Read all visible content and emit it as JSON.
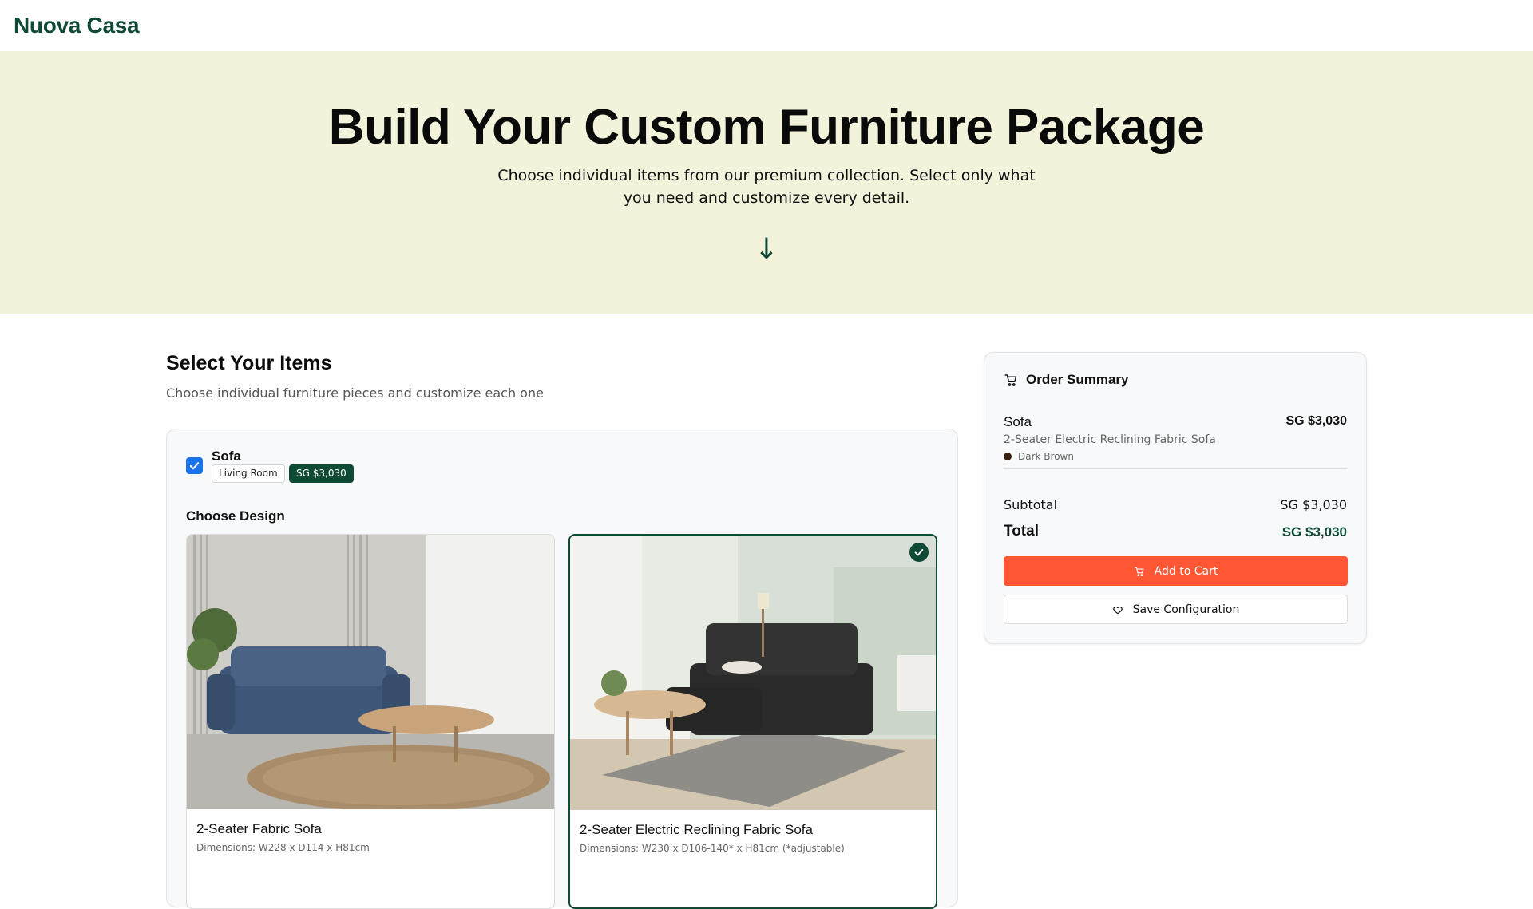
{
  "header": {
    "brand": "Nuova Casa"
  },
  "hero": {
    "title": "Build Your Custom Furniture Package",
    "subtitle": "Choose individual items from our premium collection. Select only what you need and customize every detail.",
    "arrow": "↓"
  },
  "items_section": {
    "title": "Select Your Items",
    "subtitle": "Choose individual furniture pieces and customize each one",
    "item": {
      "name": "Sofa",
      "checked": true,
      "room_tag": "Living Room",
      "price_tag": "SG $3,030",
      "choose_design_label": "Choose Design",
      "designs": [
        {
          "name": "2-Seater Fabric Sofa",
          "dimensions": "Dimensions: W228 x D114 x H81cm",
          "selected": false
        },
        {
          "name": "2-Seater Electric Reclining Fabric Sofa",
          "dimensions": "Dimensions: W230 x D106-140* x H81cm (*adjustable)",
          "selected": true
        }
      ]
    }
  },
  "summary": {
    "title": "Order Summary",
    "line_item": {
      "name": "Sofa",
      "price": "SG $3,030",
      "description": "2-Seater Electric Reclining Fabric Sofa",
      "color_name": "Dark Brown",
      "color_hex": "#3b1f0e"
    },
    "subtotal_label": "Subtotal",
    "subtotal_value": "SG $3,030",
    "total_label": "Total",
    "total_value": "SG $3,030",
    "add_to_cart_label": "Add to Cart",
    "save_label": "Save Configuration"
  },
  "colors": {
    "brand_green": "#0f4a35",
    "hero_bg": "#f3f3dc",
    "cta_orange": "#ff5733",
    "checkbox_blue": "#1a73e8"
  },
  "icons": {
    "cart": "cart-icon",
    "heart": "heart-icon",
    "check": "check-icon",
    "arrow": "arrow-down-icon"
  }
}
